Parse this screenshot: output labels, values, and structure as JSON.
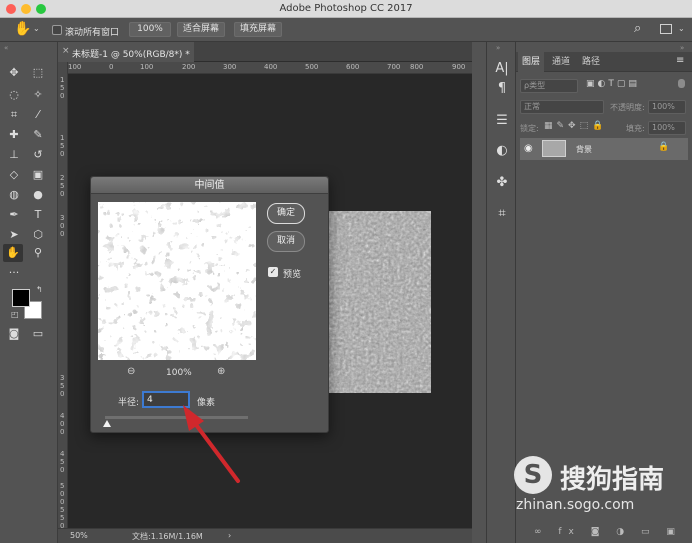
{
  "window": {
    "title": "Adobe Photoshop CC 2017"
  },
  "options_bar": {
    "scroll_all_label": "滚动所有窗口",
    "zoom_100_label": "100%",
    "fit_screen_label": "适合屏幕",
    "fill_screen_label": "填充屏幕"
  },
  "document": {
    "tab_label": "未标题-1 @ 50%(RGB/8*) *",
    "ruler_top": [
      "100",
      "0",
      "100",
      "200",
      "300",
      "400",
      "500",
      "600",
      "700",
      "800",
      "900"
    ],
    "ruler_left": [
      "1",
      "5",
      "0",
      "1",
      "5",
      "0",
      "2",
      "5",
      "0",
      "3",
      "0",
      "0",
      "3",
      "5",
      "0",
      "4",
      "0",
      "0",
      "4",
      "5",
      "0",
      "5",
      "0",
      "0",
      "5",
      "5",
      "0",
      "6",
      "0",
      "0"
    ],
    "zoom": "50%",
    "doc_info": "文档:1.16M/1.16M"
  },
  "layers_panel": {
    "tabs": [
      "图层",
      "通道",
      "路径"
    ],
    "filter_label": "ρ类型",
    "blend_mode": "正常",
    "opacity_label": "不透明度:",
    "opacity_value": "100%",
    "lock_label": "锁定:",
    "fill_label": "填充:",
    "fill_value": "100%",
    "layer_name": "背景"
  },
  "dialog": {
    "title": "中间值",
    "ok_label": "确定",
    "cancel_label": "取消",
    "preview_label": "预览",
    "zoom_value": "100%",
    "radius_label": "半径:",
    "radius_value": "4",
    "radius_unit": "像素"
  },
  "watermark": {
    "brand": "搜狗指南",
    "url": "zhinan.sogo.com",
    "logo_letter": "S"
  },
  "colors": {
    "accent": "#3d7ad1",
    "arrow": "#d0282c"
  }
}
